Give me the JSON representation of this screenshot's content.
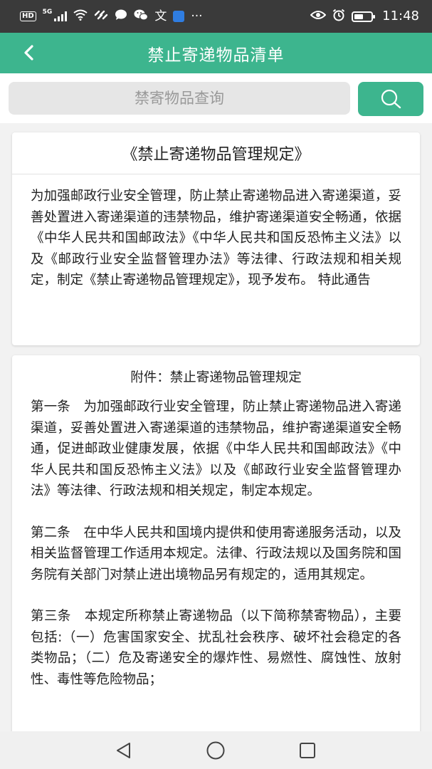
{
  "status_bar": {
    "hd": "HD",
    "network": "5G",
    "time": "11:48",
    "icons": [
      "hd-icon",
      "signal-icon",
      "wifi-icon",
      "link-icon",
      "chat-icon",
      "wechat-icon",
      "translate-icon",
      "app-icon",
      "more-icon",
      "eye-icon",
      "alarm-icon",
      "battery-icon"
    ],
    "more": "···"
  },
  "header": {
    "back_icon": "chevron-left-icon",
    "title": "禁止寄递物品清单"
  },
  "search": {
    "placeholder": "禁寄物品查询",
    "value": "",
    "button_icon": "search-icon"
  },
  "notice": {
    "title": "《禁止寄递物品管理规定》",
    "body": "为加强邮政行业安全管理，防止禁止寄递物品进入寄递渠道，妥善处置进入寄递渠道的违禁物品，维护寄递渠道安全畅通，依据《中华人民共和国邮政法》《中华人民共和国反恐怖主义法》以及《邮政行业安全监督管理办法》等法律、行政法规和相关规定，制定《禁止寄递物品管理规定》，现予发布。 特此通告"
  },
  "attachment": {
    "title": "附件：禁止寄递物品管理规定",
    "articles": [
      "第一条　为加强邮政行业安全管理，防止禁止寄递物品进入寄递渠道，妥善处置进入寄递渠道的违禁物品，维护寄递渠道安全畅通，促进邮政业健康发展，依据《中华人民共和国邮政法》《中华人民共和国反恐怖主义法》以及《邮政行业安全监督管理办法》等法律、行政法规和相关规定，制定本规定。",
      "第二条　在中华人民共和国境内提供和使用寄递服务活动，以及相关监督管理工作适用本规定。法律、行政法规以及国务院和国务院有关部门对禁止进出境物品另有规定的，适用其规定。",
      "第三条　本规定所称禁止寄递物品（以下简称禁寄物品），主要包括:（一）危害国家安全、扰乱社会秩序、破坏社会稳定的各类物品；（二）危及寄递安全的爆炸性、易燃性、腐蚀性、放射性、毒性等危险物品；"
    ]
  },
  "nav": {
    "back_icon": "triangle-back-icon",
    "home_icon": "circle-home-icon",
    "recents_icon": "square-recents-icon"
  },
  "colors": {
    "accent": "#3db58e",
    "status_bar": "#3a3a3a",
    "background": "#f2f2f2"
  }
}
